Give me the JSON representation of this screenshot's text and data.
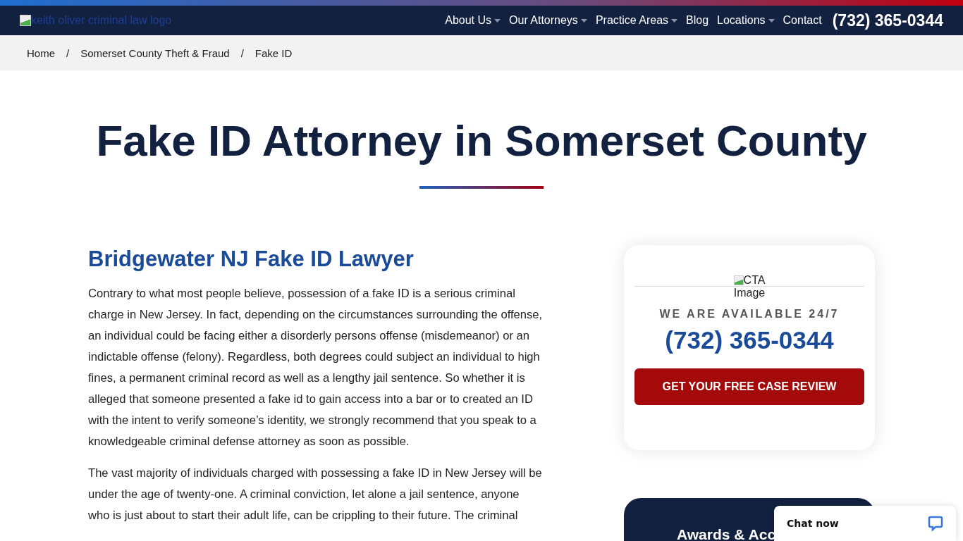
{
  "header": {
    "logo_alt": "keith oliver criminal law logo",
    "nav": [
      {
        "label": "About Us",
        "has_dropdown": true
      },
      {
        "label": "Our Attorneys",
        "has_dropdown": true
      },
      {
        "label": "Practice Areas",
        "has_dropdown": true
      },
      {
        "label": "Blog",
        "has_dropdown": false
      },
      {
        "label": "Locations",
        "has_dropdown": true
      },
      {
        "label": "Contact",
        "has_dropdown": false
      }
    ],
    "phone": "(732) 365-0344"
  },
  "breadcrumb": {
    "separator": "/",
    "items": [
      "Home",
      "Somerset County Theft & Fraud",
      "Fake ID"
    ]
  },
  "page_title": "Fake ID Attorney in Somerset County",
  "article": {
    "heading": "Bridgewater NJ Fake ID Lawyer",
    "paragraphs": [
      "Contrary to what most people believe, possession of a fake ID is a serious criminal charge in New Jersey. In fact, depending on the circumstances surrounding the offense, an individual could be facing either a disorderly persons offense (misdemeanor) or an indictable offense (felony). Regardless, both degrees could subject an individual to high fines, a permanent criminal record as well as a lengthy jail sentence. So whether it is alleged that someone presented a fake id to gain access into a bar or to created an ID with the intent to verify someone’s identity, we strongly recommend that you speak to a knowledgeable criminal defense attorney as soon as possible.",
      "The vast majority of individuals charged with possessing a fake ID in New Jersey will be under the age of twenty-one. A criminal conviction, let alone a jail sentence, anyone who is just about to start their adult life, can be crippling to their future. The criminal"
    ]
  },
  "cta": {
    "image_alt": "CTA Image",
    "availability": "WE ARE AVAILABLE 24/7",
    "phone": "(732) 365-0344",
    "button": "GET YOUR FREE CASE REVIEW"
  },
  "awards": {
    "title": "Awards & Acc"
  },
  "chat": {
    "label": "Chat now"
  }
}
